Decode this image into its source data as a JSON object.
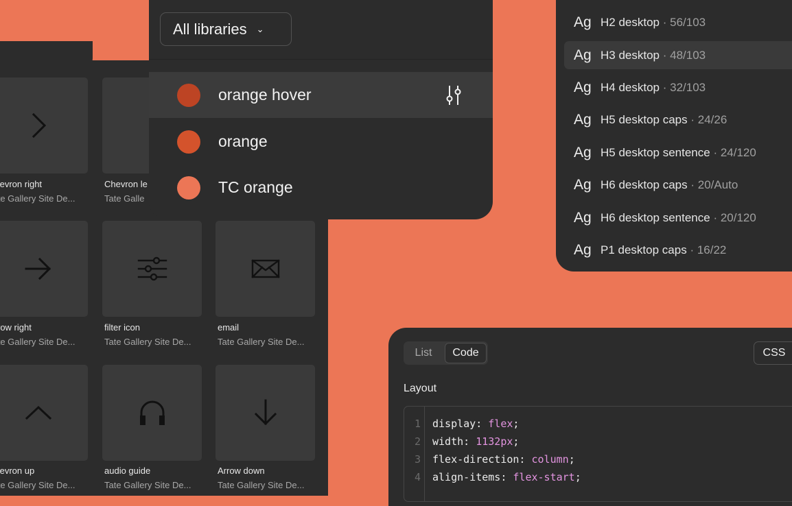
{
  "colors": {
    "background": "#ec7656",
    "panel": "#2c2c2c",
    "code_value": "#e394e0"
  },
  "icons_grid": {
    "tiles": [
      {
        "icon": "chevron-right-icon",
        "name": "Chevron right",
        "library": "Tate Gallery Site De..."
      },
      {
        "icon": "chevron-left-icon",
        "name": "Chevron le",
        "library": "Tate Galle"
      },
      {
        "icon": "arrow-right-icon",
        "name": "Arrow right",
        "library": "Tate Gallery Site De..."
      },
      {
        "icon": "filter-icon",
        "name": "filter icon",
        "library": "Tate Gallery Site De..."
      },
      {
        "icon": "email-icon",
        "name": "email",
        "library": "Tate Gallery Site De..."
      },
      {
        "icon": "chevron-up-icon",
        "name": "Chevron up",
        "library": "Tate Gallery Site De..."
      },
      {
        "icon": "headphones-icon",
        "name": "audio guide",
        "library": "Tate Gallery Site De..."
      },
      {
        "icon": "arrow-down-icon",
        "name": "Arrow down",
        "library": "Tate Gallery Site De..."
      }
    ]
  },
  "library_menu": {
    "selected": "All libraries",
    "colors": [
      {
        "label": "orange hover",
        "swatch": "#bd4424",
        "hovered": true
      },
      {
        "label": "orange",
        "swatch": "#d4532c",
        "hovered": false
      },
      {
        "label": "TC orange",
        "swatch": "#ec7656",
        "hovered": false
      }
    ]
  },
  "text_styles": {
    "items": [
      {
        "preview": "Ag",
        "name": "H2 desktop",
        "meta": "· 56/103",
        "selected": false
      },
      {
        "preview": "Ag",
        "name": "H3 desktop",
        "meta": "· 48/103",
        "selected": true
      },
      {
        "preview": "Ag",
        "name": "H4 desktop",
        "meta": "· 32/103",
        "selected": false
      },
      {
        "preview": "Ag",
        "name": "H5 desktop caps",
        "meta": "· 24/26",
        "selected": false
      },
      {
        "preview": "Ag",
        "name": "H5 desktop sentence",
        "meta": "· 24/120",
        "selected": false
      },
      {
        "preview": "Ag",
        "name": "H6 desktop caps",
        "meta": "· 20/Auto",
        "selected": false
      },
      {
        "preview": "Ag",
        "name": "H6 desktop sentence",
        "meta": "· 20/120",
        "selected": false
      },
      {
        "preview": "Ag",
        "name": "P1 desktop caps",
        "meta": "· 16/22",
        "selected": false
      }
    ]
  },
  "code_view": {
    "tabs": [
      "List",
      "Code"
    ],
    "active_tab": "Code",
    "language": "CSS",
    "section": "Layout",
    "lines": [
      {
        "num": "1",
        "prop": "display: ",
        "value": "flex"
      },
      {
        "num": "2",
        "prop": "width: ",
        "value": "1132px"
      },
      {
        "num": "3",
        "prop": "flex-direction: ",
        "value": "column"
      },
      {
        "num": "4",
        "prop": "align-items: ",
        "value": "flex-start"
      }
    ]
  }
}
